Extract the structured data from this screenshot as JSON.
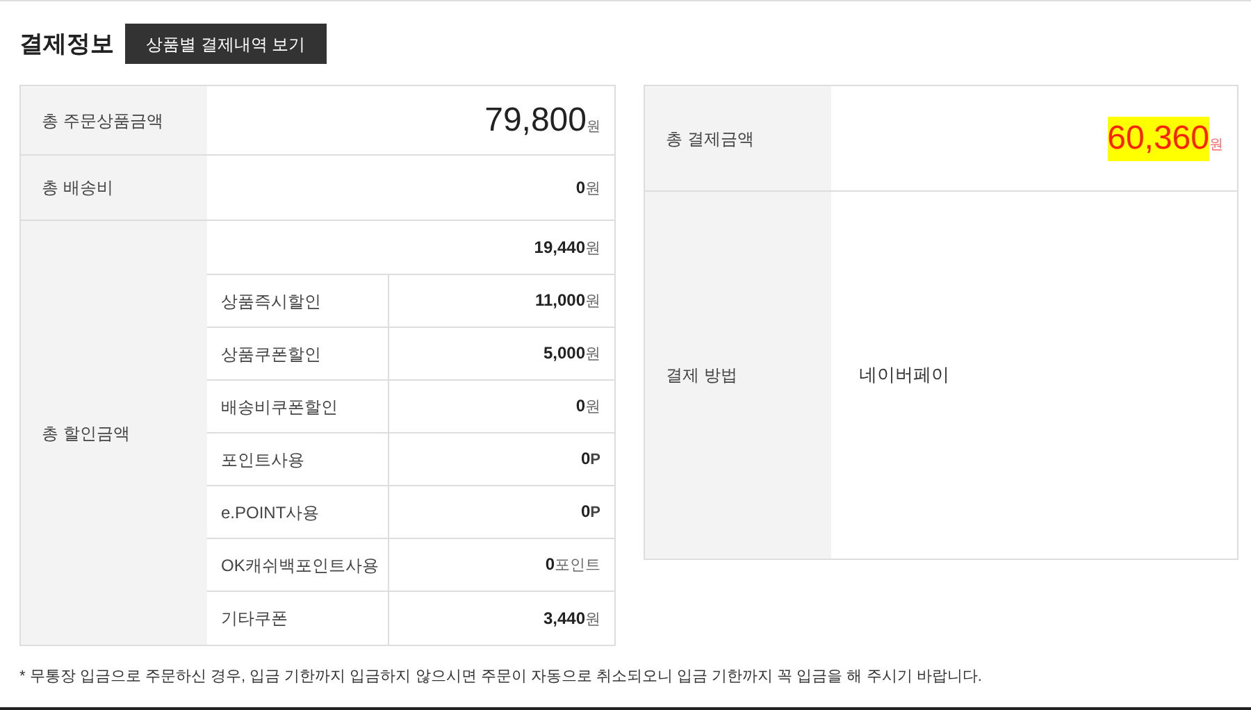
{
  "title": "결제정보",
  "detail_button": "상품별 결제내역 보기",
  "order_total": {
    "label": "총 주문상품금액",
    "amount": "79,800",
    "unit": "원"
  },
  "shipping": {
    "label": "총 배송비",
    "amount": "0",
    "unit": "원"
  },
  "discount": {
    "label": "총 할인금액",
    "amount": "19,440",
    "unit": "원",
    "items": [
      {
        "label": "상품즉시할인",
        "amount": "11,000",
        "unit": "원"
      },
      {
        "label": "상품쿠폰할인",
        "amount": "5,000",
        "unit": "원"
      },
      {
        "label": "배송비쿠폰할인",
        "amount": "0",
        "unit": "원"
      },
      {
        "label": "포인트사용",
        "amount": "0",
        "unit": "P"
      },
      {
        "label": "e.POINT사용",
        "amount": "0",
        "unit": "P"
      },
      {
        "label": "OK캐쉬백포인트사용",
        "amount": "0",
        "unit": "포인트"
      },
      {
        "label": "기타쿠폰",
        "amount": "3,440",
        "unit": "원"
      }
    ]
  },
  "payment_total": {
    "label": "총 결제금액",
    "amount": "60,360",
    "unit": "원",
    "highlighted": true
  },
  "payment_method": {
    "label": "결제 방법",
    "value": "네이버페이"
  },
  "footnote": "* 무통장 입금으로 주문하신 경우, 입금 기한까지 입금하지 않으시면 주문이 자동으로 취소되오니 입금 기한까지 꼭 입금을 해 주시기 바랍니다."
}
